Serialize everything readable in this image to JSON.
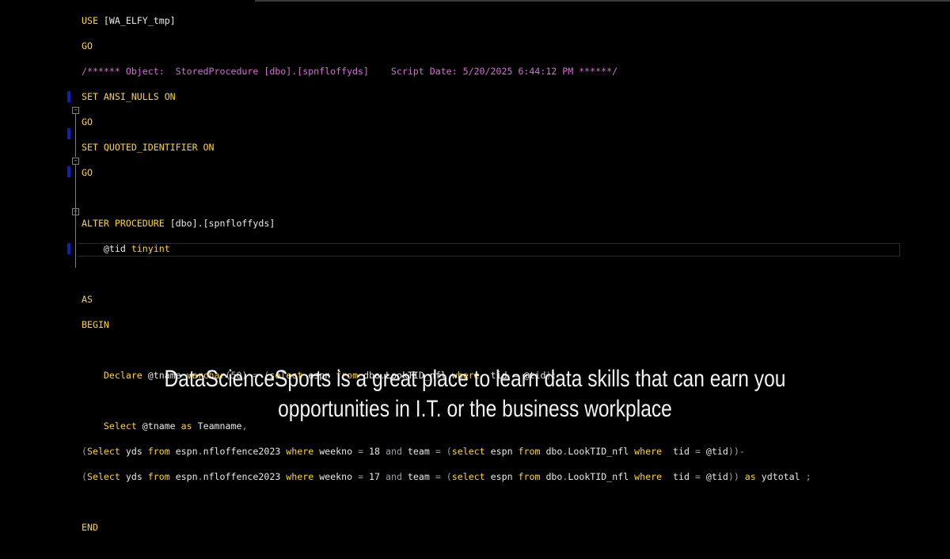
{
  "editor": {
    "lines": {
      "l1": {
        "a": "USE ",
        "b": "[WA_ELFY_tmp]"
      },
      "l2": {
        "a": "GO"
      },
      "l3": {
        "a": "/****** Object:  StoredProcedure [dbo].[spnfloffyds]    Script Date: 5/20/2025 6:44:12 PM ******/"
      },
      "l4": {
        "a": "SET ANSI_NULLS ON"
      },
      "l5": {
        "a": "GO"
      },
      "l6": {
        "a": "SET QUOTED_IDENTIFIER ON"
      },
      "l7": {
        "a": "GO"
      },
      "l9": {
        "a": "ALTER PROCEDURE ",
        "b": "[dbo].[spnfloffyds]"
      },
      "l10": {
        "a": "    @tid ",
        "b": "tinyint"
      },
      "l12": {
        "a": "AS"
      },
      "l13": {
        "a": "BEGIN"
      },
      "l15": {
        "a": "    Declare ",
        "b": "@tname ",
        "c": "varchar",
        "d": "(50) ",
        "e": "= ",
        "f": "(",
        "g": "select ",
        "h": "espn ",
        "i": "from ",
        "j": "dbo",
        "k": ".",
        "l": "LookTID_nfl ",
        "m": "where  ",
        "n": "tid ",
        "o": "= ",
        "p": "@tid",
        "q": ");"
      },
      "l17": {
        "a": "    Select ",
        "b": "@tname ",
        "c": "as ",
        "d": "Teamname",
        "e": ","
      },
      "l18": {
        "a": "(",
        "b": "Select ",
        "c": "yds ",
        "d": "from ",
        "e": "espn",
        "f": ".",
        "g": "nfloffence2023 ",
        "h": "where ",
        "i": "weekno ",
        "j": "= ",
        "k": "18 ",
        "l": "and ",
        "m": "team ",
        "n": "= ",
        "o": "(",
        "p": "select ",
        "q": "espn ",
        "r": "from ",
        "s": "dbo",
        "t": ".",
        "u": "LookTID_nfl ",
        "v": "where  ",
        "w": "tid ",
        "x": "= ",
        "y": "@tid",
        "z": "))-"
      },
      "l19": {
        "a": "(",
        "b": "Select ",
        "c": "yds ",
        "d": "from ",
        "e": "espn",
        "f": ".",
        "g": "nfloffence2023 ",
        "h": "where ",
        "i": "weekno ",
        "j": "= ",
        "k": "17 ",
        "l": "and ",
        "m": "team ",
        "n": "= ",
        "o": "(",
        "p": "select ",
        "q": "espn ",
        "r": "from ",
        "s": "dbo",
        "t": ".",
        "u": "LookTID_nfl ",
        "v": "where  ",
        "w": "tid ",
        "x": "= ",
        "y": "@tid",
        "z": ")) ",
        "aa": "as ",
        "ab": "ydtotal ",
        "ac": ";"
      },
      "l21": {
        "a": "END"
      }
    },
    "colors": {
      "keyword": "#ffd42a",
      "comment": "#d36fd3",
      "operator": "#9aa0a6",
      "change_marker": "#0a24b8",
      "background": "#000000"
    }
  },
  "caption": {
    "line1": "DataScienceSports is a great place to learn data skills that can earn you",
    "line2": "opportunities in I.T. or the business workplace"
  }
}
